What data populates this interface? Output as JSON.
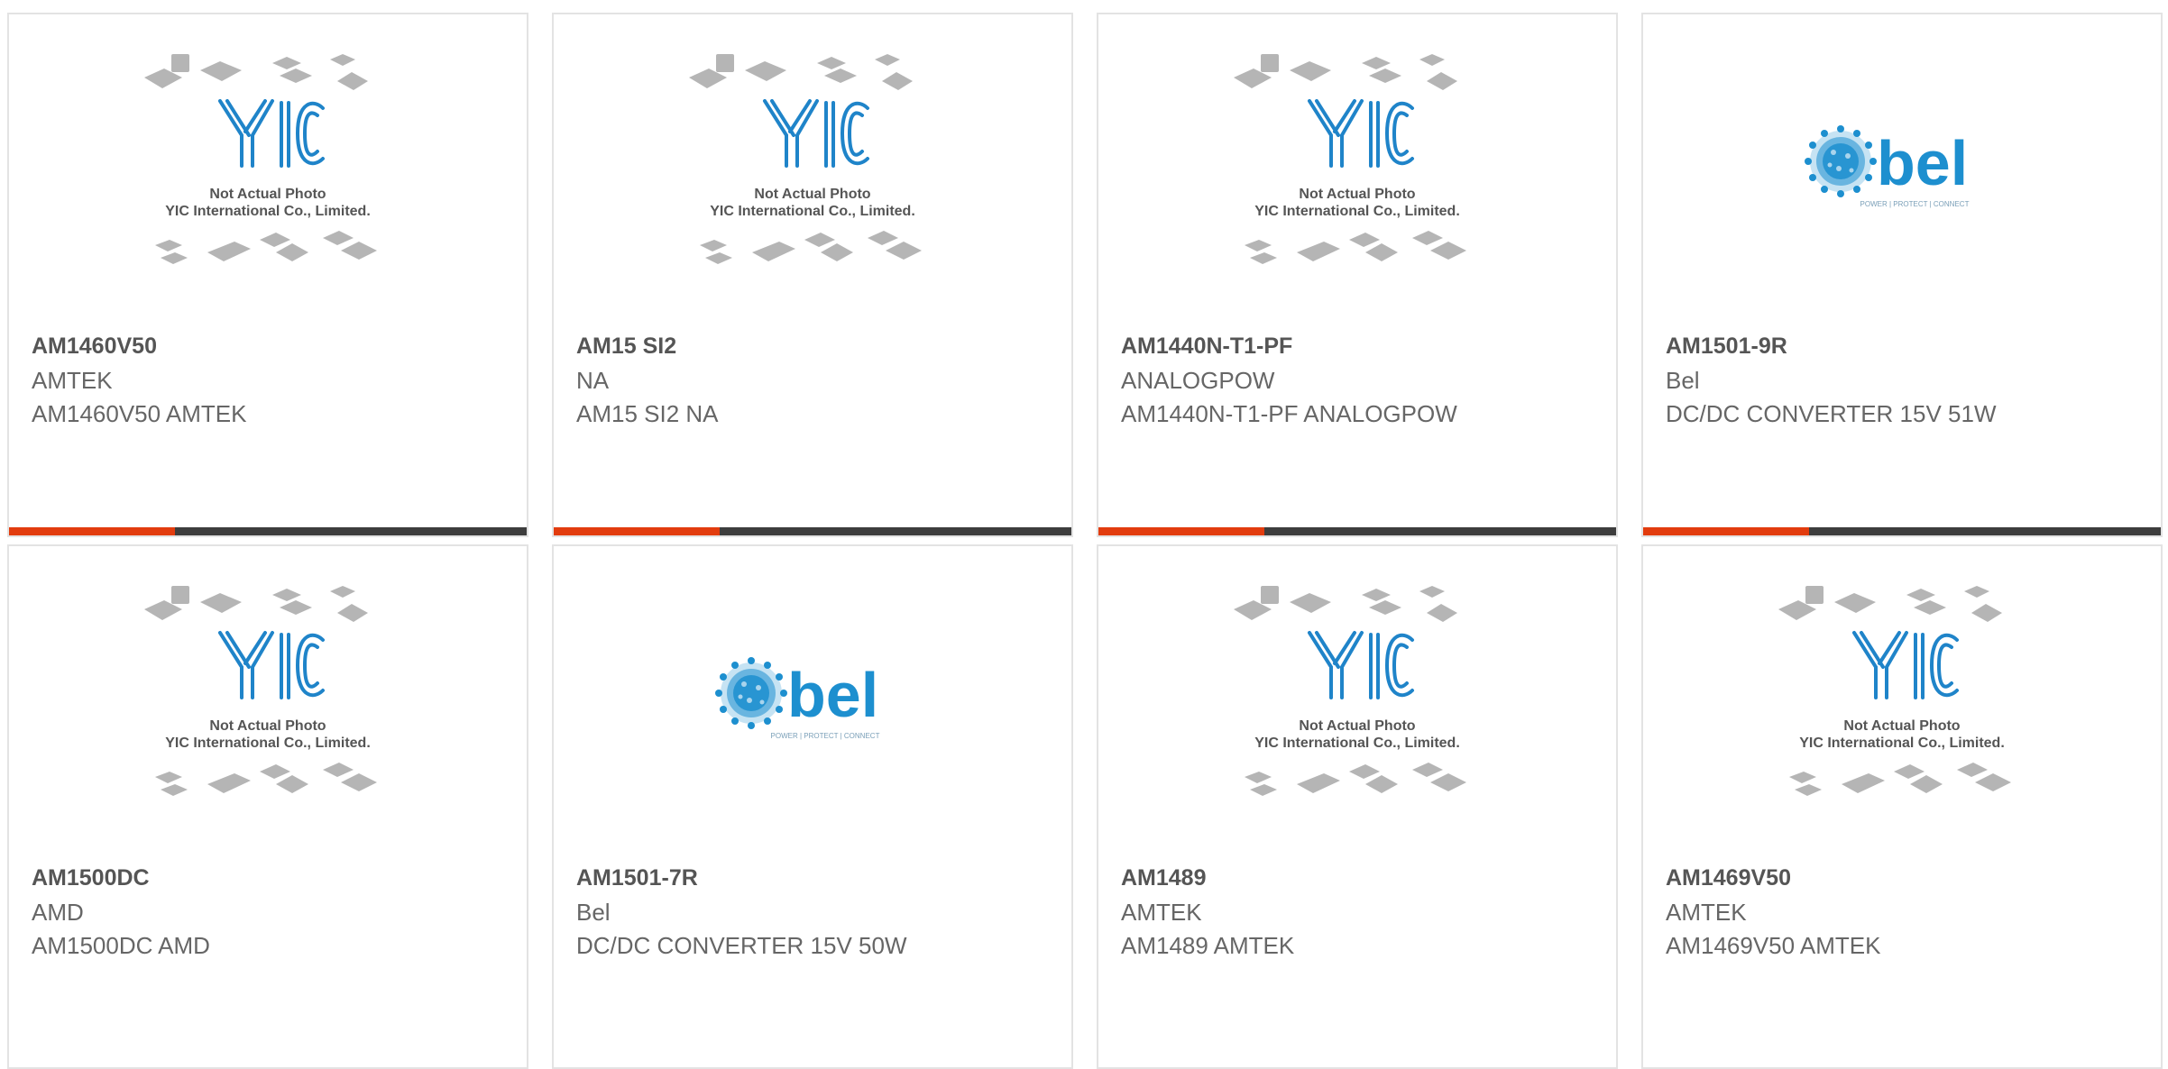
{
  "colors": {
    "accent": "#e23c0e",
    "bar": "#3d3d3d",
    "yic_blue": "#1f84c9",
    "bel_blue": "#1d8fcf"
  },
  "placeholder": {
    "line1": "Not Actual Photo",
    "line2": "YIC International Co., Limited."
  },
  "bel": {
    "wordmark": "bel",
    "tagline": "POWER | PROTECT | CONNECT"
  },
  "products": [
    {
      "part": "AM1460V50",
      "manufacturer": "AMTEK",
      "description": "AM1460V50 AMTEK",
      "image": "yic-placeholder",
      "progress": 0.32
    },
    {
      "part": "AM15 SI2",
      "manufacturer": "NA",
      "description": "AM15 SI2 NA",
      "image": "yic-placeholder",
      "progress": 0.32
    },
    {
      "part": "AM1440N-T1-PF",
      "manufacturer": "ANALOGPOW",
      "description": "AM1440N-T1-PF ANALOGPOW",
      "image": "yic-placeholder",
      "progress": 0.32
    },
    {
      "part": "AM1501-9R",
      "manufacturer": "Bel",
      "description": "DC/DC CONVERTER 15V 51W",
      "image": "bel-logo",
      "progress": 0.32
    },
    {
      "part": "AM1500DC",
      "manufacturer": "AMD",
      "description": "AM1500DC AMD",
      "image": "yic-placeholder"
    },
    {
      "part": "AM1501-7R",
      "manufacturer": "Bel",
      "description": "DC/DC CONVERTER 15V 50W",
      "image": "bel-logo"
    },
    {
      "part": "AM1489",
      "manufacturer": "AMTEK",
      "description": "AM1489 AMTEK",
      "image": "yic-placeholder"
    },
    {
      "part": "AM1469V50",
      "manufacturer": "AMTEK",
      "description": "AM1469V50 AMTEK",
      "image": "yic-placeholder"
    }
  ]
}
